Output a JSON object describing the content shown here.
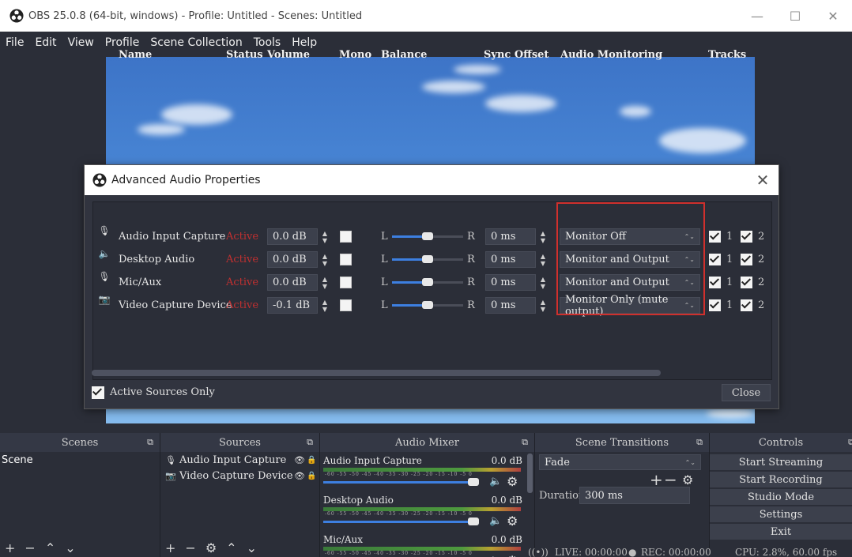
{
  "window": {
    "title": "OBS 25.0.8 (64-bit, windows) - Profile: Untitled - Scenes: Untitled",
    "minimize": "—",
    "maximize": "☐",
    "close": "✕"
  },
  "menubar": [
    "File",
    "Edit",
    "View",
    "Profile",
    "Scene Collection",
    "Tools",
    "Help"
  ],
  "dialog": {
    "title": "Advanced Audio Properties",
    "close": "✕",
    "headers": {
      "name": "Name",
      "status": "Status",
      "volume": "Volume",
      "mono": "Mono",
      "balance": "Balance",
      "sync": "Sync Offset",
      "monitoring": "Audio Monitoring",
      "tracks": "Tracks"
    },
    "balance_left": "L",
    "balance_right": "R",
    "rows": [
      {
        "icon": "microphone-icon",
        "glyph": "🎙",
        "name": "Audio Input Capture",
        "status": "Active",
        "volume": "0.0 dB",
        "mono": false,
        "balance": 0.5,
        "sync": "0 ms",
        "monitoring": "Monitor Off",
        "track1": "1",
        "track2": "2"
      },
      {
        "icon": "speaker-icon",
        "glyph": "🔈",
        "name": "Desktop Audio",
        "status": "Active",
        "volume": "0.0 dB",
        "mono": false,
        "balance": 0.5,
        "sync": "0 ms",
        "monitoring": "Monitor and Output",
        "track1": "1",
        "track2": "2"
      },
      {
        "icon": "microphone-icon",
        "glyph": "🎙",
        "name": "Mic/Aux",
        "status": "Active",
        "volume": "0.0 dB",
        "mono": false,
        "balance": 0.5,
        "sync": "0 ms",
        "monitoring": "Monitor and Output",
        "track1": "1",
        "track2": "2"
      },
      {
        "icon": "camera-icon",
        "glyph": "📷",
        "name": "Video Capture Device",
        "status": "Active",
        "volume": "-0.1 dB",
        "mono": false,
        "balance": 0.5,
        "sync": "0 ms",
        "monitoring": "Monitor Only (mute output)",
        "track1": "1",
        "track2": "2"
      }
    ],
    "active_only_label": "Active Sources Only",
    "close_button": "Close"
  },
  "docks": {
    "scenes": {
      "title": "Scenes",
      "items": [
        "Scene"
      ]
    },
    "sources": {
      "title": "Sources",
      "items": [
        {
          "glyph": "🎙",
          "name": "Audio Input Capture"
        },
        {
          "glyph": "📷",
          "name": "Video Capture Device"
        }
      ]
    },
    "mixer": {
      "title": "Audio Mixer",
      "ticks": "-60  -55  -50  -45  -40  -35  -30  -25  -20  -15  -10  -5  0",
      "channels": [
        {
          "name": "Audio Input Capture",
          "db": "0.0 dB",
          "volume": 1.0
        },
        {
          "name": "Desktop Audio",
          "db": "0.0 dB",
          "volume": 1.0
        },
        {
          "name": "Mic/Aux",
          "db": "0.0 dB",
          "volume": 1.0
        }
      ]
    },
    "transitions": {
      "title": "Scene Transitions",
      "selected": "Fade",
      "duration_label": "Duration",
      "duration_value": "300 ms"
    },
    "controls": {
      "title": "Controls",
      "buttons": [
        "Start Streaming",
        "Start Recording",
        "Studio Mode",
        "Settings",
        "Exit"
      ]
    }
  },
  "status": {
    "live": "LIVE: 00:00:00",
    "rec": "REC: 00:00:00",
    "cpu": "CPU: 2.8%, 60.00 fps"
  },
  "colors": {
    "accent": "#3d7fe0",
    "status_active": "#c03030",
    "highlight_border": "#d0302d",
    "background": "#2b2e38"
  }
}
